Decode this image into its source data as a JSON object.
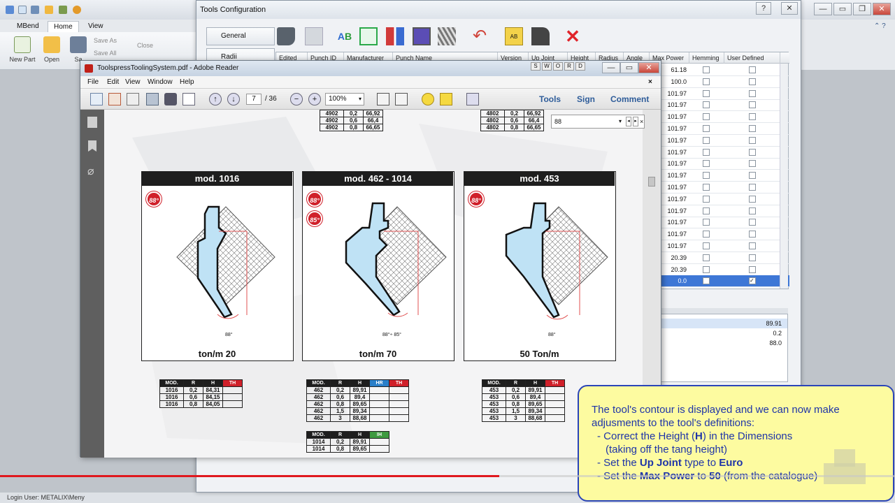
{
  "mbend": {
    "tabs": [
      "MBend",
      "Home",
      "View"
    ],
    "ribbon": {
      "new_part": "New Part",
      "open": "Open",
      "save": "Sa",
      "save_as": "Save As",
      "save_all": "Save All",
      "close": "Close"
    },
    "status": "Login User: METALIX\\Meny"
  },
  "tools_config": {
    "title": "Tools Configuration",
    "title_buttons": [
      "?",
      "—",
      "✕"
    ],
    "side_tabs": [
      "General",
      "Radii"
    ],
    "columns": [
      "Edited",
      "Punch ID",
      "Manufacturer",
      "Punch Name",
      "Version",
      "Up Joint",
      "Height",
      "Radius",
      "Angle",
      "Max Power",
      "Hemming",
      "User Defined"
    ],
    "max_power_values": [
      "61.18",
      "100.0",
      "101.97",
      "101.97",
      "101.97",
      "101.97",
      "101.97",
      "101.97",
      "101.97",
      "101.97",
      "101.97",
      "101.97",
      "101.97",
      "101.97",
      "101.97",
      "101.97",
      "20.39",
      "20.39",
      "0.0"
    ],
    "dimensions": [
      "89.91",
      "0.2",
      "88.0"
    ]
  },
  "adobe": {
    "title": "ToolspressToolingSystem.pdf - Adobe Reader",
    "menu": [
      "File",
      "Edit",
      "View",
      "Window",
      "Help"
    ],
    "page": "7",
    "page_total": "/ 36",
    "zoom": "100%",
    "right_links": [
      "Tools",
      "Sign",
      "Comment"
    ],
    "find_value": "88",
    "find_options": [
      "S",
      "W",
      "O",
      "R",
      "D"
    ]
  },
  "catalogue": {
    "top_left_table": [
      [
        "4902",
        "0,2",
        "66,92"
      ],
      [
        "4902",
        "0,6",
        "66,4"
      ],
      [
        "4902",
        "0,8",
        "66,65"
      ]
    ],
    "top_right_table": [
      [
        "4802",
        "0,2",
        "66,92"
      ],
      [
        "4802",
        "0,6",
        "66,4"
      ],
      [
        "4802",
        "0,8",
        "66,65"
      ]
    ],
    "cards": [
      {
        "title": "mod. 1016",
        "badges": [
          "88°"
        ],
        "ton": "ton/m 20",
        "angle": "88°"
      },
      {
        "title": "mod. 462 - 1014",
        "badges": [
          "88°",
          "85°"
        ],
        "ton": "ton/m 70",
        "angle": "88°÷ 85°"
      },
      {
        "title": "mod. 453",
        "badges": [
          "88°"
        ],
        "ton": "50 Ton/m",
        "angle": "88°"
      }
    ],
    "table_1016": {
      "headers": [
        "MOD.",
        "R",
        "H",
        "TH"
      ],
      "rows": [
        [
          "1016",
          "0,2",
          "84,31",
          ""
        ],
        [
          "1016",
          "0,6",
          "84,15",
          ""
        ],
        [
          "1016",
          "0,8",
          "84,05",
          ""
        ]
      ]
    },
    "table_462": {
      "headers": [
        "MOD.",
        "R",
        "H",
        "HR",
        "TH"
      ],
      "rows": [
        [
          "462",
          "0,2",
          "89,91",
          "",
          ""
        ],
        [
          "462",
          "0,6",
          "89,4",
          "",
          ""
        ],
        [
          "462",
          "0,8",
          "89,65",
          "",
          ""
        ],
        [
          "462",
          "1,5",
          "89,34",
          "",
          ""
        ],
        [
          "462",
          "3",
          "88,68",
          "",
          ""
        ]
      ]
    },
    "table_1014": {
      "headers": [
        "MOD.",
        "R",
        "H",
        "IH"
      ],
      "rows": [
        [
          "1014",
          "0,2",
          "89,91",
          ""
        ],
        [
          "1014",
          "0,8",
          "89,65",
          ""
        ]
      ]
    },
    "table_453": {
      "headers": [
        "MOD.",
        "R",
        "H",
        "TH"
      ],
      "rows": [
        [
          "453",
          "0,2",
          "89,91",
          ""
        ],
        [
          "453",
          "0,6",
          "89,4",
          ""
        ],
        [
          "453",
          "0,8",
          "89,65",
          ""
        ],
        [
          "453",
          "1,5",
          "89,34",
          ""
        ],
        [
          "453",
          "3",
          "88,68",
          ""
        ]
      ]
    }
  },
  "note": {
    "line1": "The tool's contour is displayed and we can now make",
    "line2": "adjusments to the tool's definitions:",
    "line3a": "- Correct the Height (",
    "line3b": "H",
    "line3c": ") in the Dimensions",
    "line4": "(taking off the tang height)",
    "line5a": "- Set the ",
    "line5b": "Up Joint",
    "line5c": " type to ",
    "line5d": "Euro",
    "line6a": "- Set the ",
    "line6b": "Max Power",
    "line6c": " to ",
    "line6d": "50",
    "line6e": " (from the catalogue)"
  },
  "colors": {
    "accent": "#d0202a",
    "note_bg": "#fdfba0",
    "note_text": "#1f35a8",
    "selection": "#3e77d6"
  },
  "video_progress": 0.558
}
